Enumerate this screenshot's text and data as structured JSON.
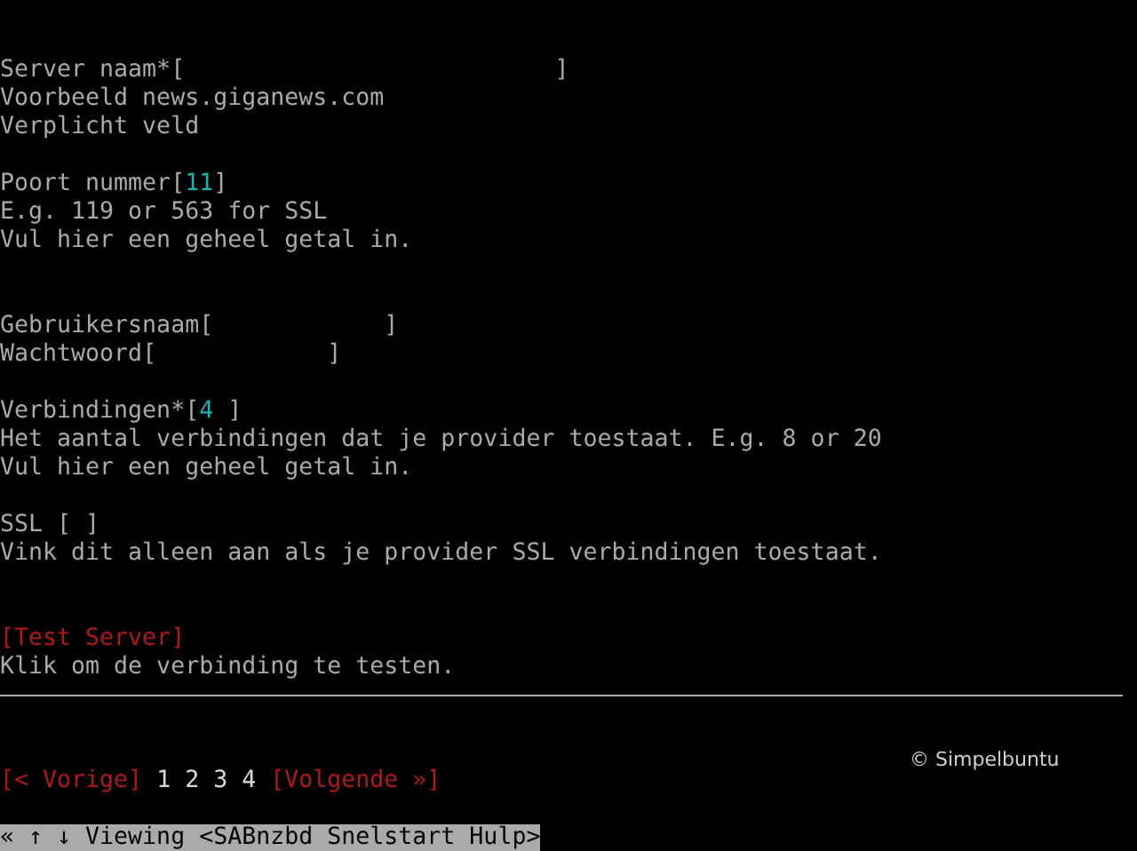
{
  "sections": [
    {
      "items": [
        {
          "kind": "field",
          "label": "Server naam*",
          "open": "[",
          "close": "]"
        },
        {
          "kind": "text",
          "text": "Voorbeeld news.giganews.com"
        },
        {
          "kind": "text",
          "text": "Verplicht veld"
        }
      ]
    },
    {
      "items": [
        {
          "kind": "field",
          "label": "Poort nummer",
          "open": "[",
          "value": "11",
          "close": "]"
        },
        {
          "kind": "text",
          "text": "E.g. 119 or 563 for SSL"
        },
        {
          "kind": "text",
          "text": "Vul hier een geheel getal in."
        }
      ]
    },
    {
      "items": [
        {
          "kind": "field",
          "label": "Gebruikersnaam",
          "open": "[",
          "close": "]"
        },
        {
          "kind": "field",
          "label": "Wachtwoord",
          "open": "[",
          "close": "]"
        }
      ]
    },
    {
      "items": [
        {
          "kind": "field",
          "label": "Verbindingen*",
          "open": "[",
          "value": "4",
          "close": "]"
        },
        {
          "kind": "text",
          "text": "Het aantal verbindingen dat je provider toestaat. E.g. 8 or 20"
        },
        {
          "kind": "text",
          "text": "Vul hier een geheel getal in."
        }
      ]
    },
    {
      "items": [
        {
          "kind": "checkbox",
          "label": "SSL",
          "open": "[",
          "close": "]",
          "checked": false
        },
        {
          "kind": "text",
          "text": "Vink dit alleen aan als je provider SSL verbindingen toestaat."
        }
      ]
    },
    {
      "items": [
        {
          "kind": "link",
          "text": "[Test Server]"
        },
        {
          "kind": "text",
          "text": "Klik om de verbinding te testen."
        }
      ]
    }
  ],
  "nav": {
    "previous": "[< Vorige]",
    "pages": [
      "1",
      "2",
      "3",
      "4"
    ],
    "next": "[Volgende »]"
  },
  "credit": "© Simpelbuntu",
  "status_bar": "« ↑ ↓ Viewing <SABnzbd Snelstart Hulp>"
}
